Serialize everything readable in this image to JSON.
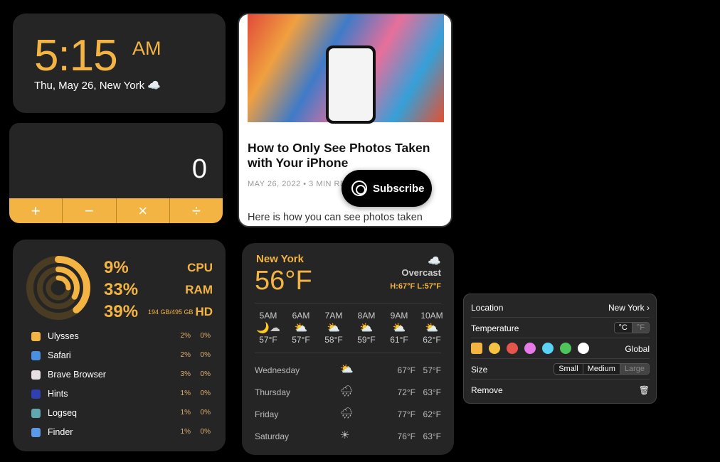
{
  "clock": {
    "time": "5:15",
    "ampm": "AM",
    "date": "Thu, May 26, New York ☁️"
  },
  "calculator": {
    "display": "0",
    "keys": [
      "+",
      "−",
      "×",
      "÷"
    ]
  },
  "article": {
    "title": "How to Only See Photos Taken with Your iPhone",
    "meta": "MAY 26, 2022  •  3 MIN READ",
    "excerpt": "Here is how you can see photos taken",
    "subscribe": "Subscribe"
  },
  "system": {
    "cpu": "9%",
    "ram": "33%",
    "hd": "39%",
    "cpu_label": "CPU",
    "ram_label": "RAM",
    "hd_label": "HD",
    "hd_detail": "194 GB/495 GB",
    "apps": [
      {
        "name": "Ulysses",
        "cpu": "2%",
        "other": "0%",
        "color": "#f3b444"
      },
      {
        "name": "Safari",
        "cpu": "2%",
        "other": "0%",
        "color": "#4a8fe0"
      },
      {
        "name": "Brave Browser",
        "cpu": "3%",
        "other": "0%",
        "color": "#e8e0e0"
      },
      {
        "name": "Hints",
        "cpu": "1%",
        "other": "0%",
        "color": "#3040b0"
      },
      {
        "name": "Logseq",
        "cpu": "1%",
        "other": "0%",
        "color": "#60a8b0"
      },
      {
        "name": "Finder",
        "cpu": "1%",
        "other": "0%",
        "color": "#5a9ae8"
      }
    ]
  },
  "weather": {
    "city": "New York",
    "temp": "56°F",
    "condition": "Overcast",
    "hilo": "H:67°F  L:57°F",
    "hourly": [
      {
        "t": "5AM",
        "i": "🌙☁",
        "v": "57°F"
      },
      {
        "t": "6AM",
        "i": "⛅",
        "v": "57°F"
      },
      {
        "t": "7AM",
        "i": "⛅",
        "v": "58°F"
      },
      {
        "t": "8AM",
        "i": "⛅",
        "v": "59°F"
      },
      {
        "t": "9AM",
        "i": "⛅",
        "v": "61°F"
      },
      {
        "t": "10AM",
        "i": "⛅",
        "v": "62°F"
      }
    ],
    "daily": [
      {
        "d": "Wednesday",
        "i": "⛅",
        "hi": "67°F",
        "lo": "57°F"
      },
      {
        "d": "Thursday",
        "i": "🌧",
        "hi": "72°F",
        "lo": "63°F"
      },
      {
        "d": "Friday",
        "i": "🌧",
        "hi": "77°F",
        "lo": "62°F"
      },
      {
        "d": "Saturday",
        "i": "☀",
        "hi": "76°F",
        "lo": "63°F"
      }
    ]
  },
  "settings": {
    "location_label": "Location",
    "location_value": "New York",
    "temperature_label": "Temperature",
    "celsius": "°C",
    "fahrenheit": "°F",
    "color_scope": "Global",
    "colors": [
      "#f3b444",
      "#f5c242",
      "#e5554a",
      "#e67ae6",
      "#5ad2f5",
      "#4ec45a",
      "#ffffff"
    ],
    "size_label": "Size",
    "sizes": [
      "Small",
      "Medium",
      "Large"
    ],
    "remove_label": "Remove"
  }
}
